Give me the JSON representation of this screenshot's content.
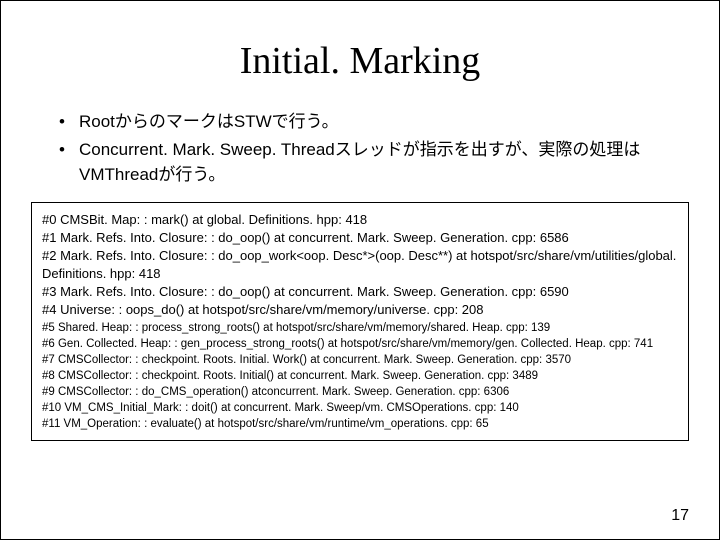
{
  "title": "Initial. Marking",
  "bullets": [
    "RootからのマークはSTWで行う。",
    "Concurrent. Mark. Sweep. Threadスレッドが指示を出すが、実際の処理はVMThreadが行う。"
  ],
  "trace": [
    "#0  CMSBit. Map: : mark() at global. Definitions. hpp: 418",
    "#1  Mark. Refs. Into. Closure: : do_oop() at concurrent. Mark. Sweep. Generation. cpp: 6586",
    "#2  Mark. Refs. Into. Closure: : do_oop_work<oop. Desc*>(oop. Desc**)  at hotspot/src/share/vm/utilities/global. Definitions. hpp: 418",
    "#3  Mark. Refs. Into. Closure: : do_oop() at concurrent. Mark. Sweep. Generation. cpp: 6590",
    "#4  Universe: : oops_do() at hotspot/src/share/vm/memory/universe. cpp: 208",
    "#5  Shared. Heap: : process_strong_roots() at hotspot/src/share/vm/memory/shared. Heap. cpp: 139",
    "#6  Gen. Collected. Heap: : gen_process_strong_roots() at hotspot/src/share/vm/memory/gen. Collected. Heap. cpp: 741",
    "#7  CMSCollector: : checkpoint. Roots. Initial. Work() at concurrent. Mark. Sweep. Generation. cpp: 3570",
    "#8  CMSCollector: : checkpoint. Roots. Initial() at concurrent. Mark. Sweep. Generation. cpp: 3489",
    "#9  CMSCollector: : do_CMS_operation() atconcurrent. Mark. Sweep. Generation. cpp: 6306",
    "#10 VM_CMS_Initial_Mark: : doit() at concurrent. Mark. Sweep/vm. CMSOperations. cpp: 140",
    "#11 VM_Operation: : evaluate() at hotspot/src/share/vm/runtime/vm_operations. cpp: 65"
  ],
  "trace_small_from": 5,
  "page_number": "17"
}
